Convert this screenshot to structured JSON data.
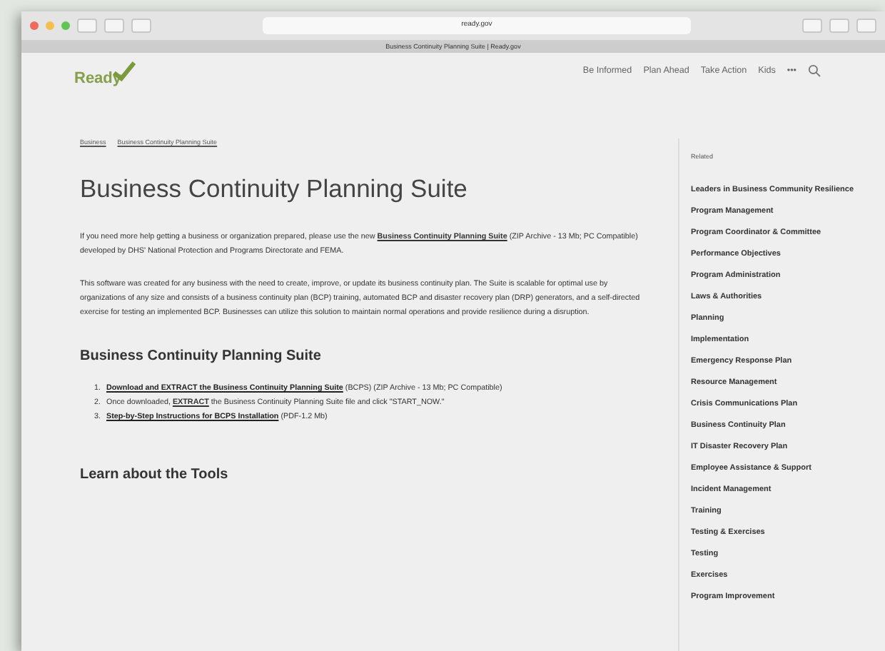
{
  "browser": {
    "address": "ready.gov",
    "tab_title": "Business Continuity Planning Suite | Ready.gov"
  },
  "site": {
    "logo": "Ready",
    "nav": [
      {
        "label": "Be Informed"
      },
      {
        "label": "Plan Ahead"
      },
      {
        "label": "Take Action"
      },
      {
        "label": "Kids"
      },
      {
        "label": "•••"
      }
    ]
  },
  "breadcrumb": [
    "Business",
    "Business Continuity Planning Suite"
  ],
  "title": "Business Continuity Planning Suite",
  "paragraphs": [
    "If you need more help getting a business or organization prepared, please use the new **Business Continuity Planning Suite** (ZIP Archive - 13 Mb; PC Compatible) developed by DHS' National Protection and Programs Directorate and FEMA.",
    "This software was created for any business with the need to create, improve, or update its business continuity plan. The Suite is scalable for optimal use by organizations of any size and consists of a business continuity plan (BCP) training, automated BCP and disaster recovery plan (DRP) generators, and a self-directed exercise for testing an implemented BCP. Businesses can utilize this solution to maintain normal operations and provide resilience during a disruption."
  ],
  "section": {
    "heading": "Business Continuity Planning Suite",
    "steps": [
      {
        "number": "1.",
        "link": "Download and EXTRACT the Business Continuity Planning Suite",
        "text": " (BCPS) (ZIP Archive - 13 Mb; PC Compatible)"
      },
      {
        "number": "2.",
        "text": "Once downloaded, **EXTRACT** the Business Continuity Planning Suite file and click \"START_NOW.\""
      },
      {
        "number": "3.",
        "link": "Step-by-Step Instructions for BCPS Installation",
        "text": " (PDF-1.2 Mb)"
      }
    ]
  },
  "section2": {
    "heading": "Learn about the Tools"
  },
  "sidebar": {
    "heading": "Related",
    "items": [
      "Leaders in Business Community Resilience",
      "Program Management",
      "Program Coordinator & Committee",
      "Performance Objectives",
      "Program Administration",
      "Laws & Authorities",
      "Planning",
      "Implementation",
      "Emergency Response Plan",
      "Resource Management",
      "Crisis Communications Plan",
      "Business Continuity Plan",
      "IT Disaster Recovery Plan",
      "Employee Assistance & Support",
      "Incident Management",
      "Training",
      "Testing & Exercises",
      "Testing",
      "Exercises",
      "Program Improvement"
    ]
  }
}
